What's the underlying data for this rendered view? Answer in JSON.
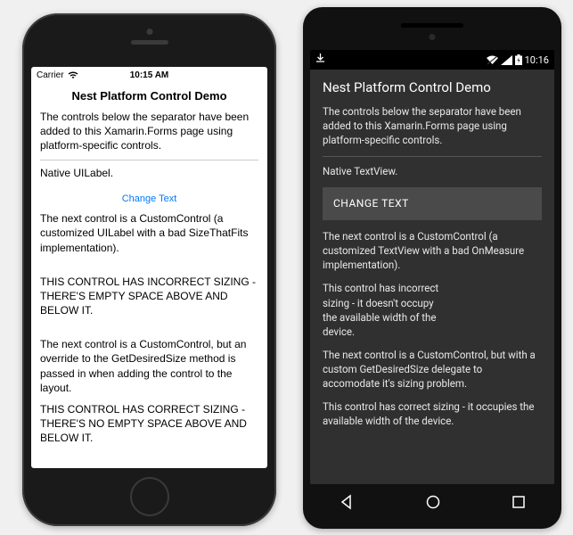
{
  "ios": {
    "status": {
      "carrier": "Carrier",
      "time": "10:15 AM"
    },
    "title": "Nest Platform Control Demo",
    "intro": "The controls below the separator have been added to this Xamarin.Forms page using platform-specific controls.",
    "native_label": "Native UILabel.",
    "change_text": "Change Text",
    "desc1": "The next control is a CustomControl (a customized UILabel with a bad SizeThatFits implementation).",
    "bad_sizing": "THIS CONTROL HAS INCORRECT SIZING - THERE'S EMPTY SPACE ABOVE AND BELOW IT.",
    "desc2": "The next control is a CustomControl, but an override to the GetDesiredSize method is passed in when adding the control to the layout.",
    "good_sizing": "THIS CONTROL HAS CORRECT SIZING - THERE'S NO EMPTY SPACE ABOVE AND BELOW IT."
  },
  "android": {
    "status": {
      "time": "10:16"
    },
    "title": "Nest Platform Control Demo",
    "intro": "The controls below the separator have been added to this Xamarin.Forms page using platform-specific controls.",
    "native_label": "Native TextView.",
    "change_text": "CHANGE TEXT",
    "desc1": "The next control is a CustomControl (a customized TextView with a bad OnMeasure implementation).",
    "bad_sizing": "This control has incorrect sizing - it doesn't occupy the available width of the device.",
    "desc2": "The next control is a CustomControl, but with a custom GetDesiredSize delegate to accomodate it's sizing problem.",
    "good_sizing": "This control has correct sizing - it occupies the available width of the device."
  }
}
